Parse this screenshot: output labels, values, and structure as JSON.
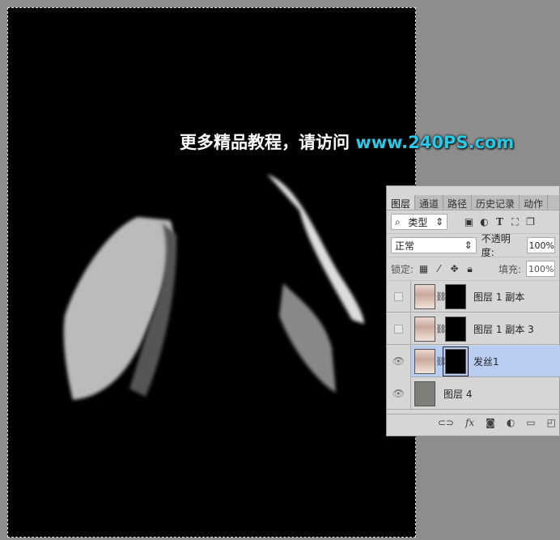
{
  "watermark": {
    "text": "更多精品教程，请访问 ",
    "url": "www.240PS.com"
  },
  "panel": {
    "tabs": [
      {
        "label": "图层"
      },
      {
        "label": "通道"
      },
      {
        "label": "路径"
      },
      {
        "label": "历史记录"
      },
      {
        "label": "动作"
      }
    ],
    "filter": {
      "label": "类型",
      "icons": [
        "search-icon",
        "image-filter-icon",
        "adjustment-filter-icon",
        "type-filter-icon",
        "shape-filter-icon",
        "smart-object-filter-icon"
      ]
    },
    "blend_mode": "正常",
    "opacity_label": "不透明度:",
    "opacity": "100%",
    "lock_label": "锁定:",
    "fill_label": "填充:",
    "fill": "100%",
    "layers": [
      {
        "name": "图层 1 副本",
        "visible": false,
        "has_mask": true,
        "selected": false
      },
      {
        "name": "图层 1 副本 3",
        "visible": false,
        "has_mask": true,
        "selected": false
      },
      {
        "name": "发丝1",
        "visible": true,
        "has_mask": true,
        "selected": true
      },
      {
        "name": "图层 4",
        "visible": true,
        "has_mask": false,
        "selected": false,
        "fill_color": "#7d7f78"
      }
    ],
    "footer_icons": [
      "link-icon",
      "fx-icon",
      "mask-icon",
      "adjustment-icon",
      "folder-icon",
      "new-layer-icon"
    ],
    "fx_label": "fx"
  },
  "colors": {
    "accent_url": "#27c9e6",
    "selected_layer": "#b9cdf2"
  }
}
